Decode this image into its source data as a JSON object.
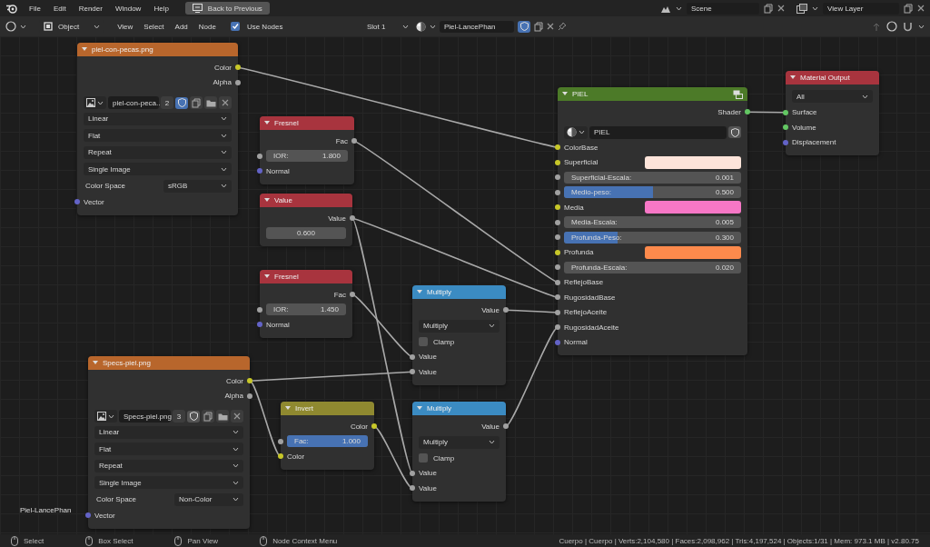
{
  "topbar": {
    "menus": [
      "File",
      "Edit",
      "Render",
      "Window",
      "Help"
    ],
    "back_button": "Back to Previous",
    "scene": "Scene",
    "view_layer": "View Layer"
  },
  "editor_header": {
    "mode": "Object",
    "menus": [
      "View",
      "Select",
      "Add",
      "Node"
    ],
    "use_nodes": {
      "label": "Use Nodes",
      "checked": true
    },
    "slot": "Slot 1",
    "material": "Piel-LancePhan",
    "fake_user": true
  },
  "nodes": [
    {
      "title": "piel-con-pecas.png",
      "kind": "texture",
      "expanded": true,
      "rows": [
        {
          "kind": "output",
          "label": "Color",
          "socket": {
            "color": "#c7c729"
          }
        },
        {
          "kind": "output",
          "label": "Alpha",
          "socket": {
            "color": "#a1a1a1"
          }
        },
        {
          "kind": "image",
          "name": "piel-con-peca...",
          "users": "2",
          "fake_user": true
        },
        {
          "kind": "dropdown",
          "value": "Linear"
        },
        {
          "kind": "dropdown",
          "value": "Flat"
        },
        {
          "kind": "dropdown",
          "value": "Repeat"
        },
        {
          "kind": "dropdown",
          "value": "Single Image"
        },
        {
          "kind": "dropdown",
          "label": "Color Space",
          "value": "sRGB"
        },
        {
          "kind": "input",
          "label": "Vector",
          "socket": {
            "color": "#6363c7"
          }
        }
      ]
    },
    {
      "title": "Fresnel",
      "kind": "input",
      "expanded": true,
      "rows": [
        {
          "kind": "output",
          "label": "Fac",
          "socket": {
            "color": "#a1a1a1"
          }
        },
        {
          "kind": "field",
          "label": "IOR:",
          "value": "1.800",
          "socket": {
            "color": "#a1a1a1"
          }
        },
        {
          "kind": "input",
          "label": "Normal",
          "socket": {
            "color": "#6363c7"
          }
        }
      ]
    },
    {
      "title": "Value",
      "kind": "input",
      "expanded": true,
      "rows": [
        {
          "kind": "output",
          "label": "Value",
          "socket": {
            "color": "#a1a1a1"
          }
        },
        {
          "kind": "field",
          "value": "0.600"
        }
      ]
    },
    {
      "title": "Fresnel",
      "kind": "input",
      "expanded": true,
      "rows": [
        {
          "kind": "output",
          "label": "Fac",
          "socket": {
            "color": "#a1a1a1"
          }
        },
        {
          "kind": "field",
          "label": "IOR:",
          "value": "1.450",
          "socket": {
            "color": "#a1a1a1"
          }
        },
        {
          "kind": "input",
          "label": "Normal",
          "socket": {
            "color": "#6363c7"
          }
        }
      ]
    },
    {
      "title": "Multiply",
      "kind": "converter",
      "expanded": true,
      "rows": [
        {
          "kind": "output",
          "label": "Value",
          "socket": {
            "color": "#a1a1a1"
          }
        },
        {
          "kind": "dropdown",
          "value": "Multiply"
        },
        {
          "kind": "checkbox",
          "label": "Clamp",
          "checked": false
        },
        {
          "kind": "input",
          "label": "Value",
          "socket": {
            "color": "#a1a1a1"
          }
        },
        {
          "kind": "input",
          "label": "Value",
          "socket": {
            "color": "#a1a1a1"
          }
        }
      ]
    },
    {
      "title": "Specs-piel.png",
      "kind": "texture",
      "expanded": true,
      "rows": [
        {
          "kind": "output",
          "label": "Color",
          "socket": {
            "color": "#c7c729"
          }
        },
        {
          "kind": "output",
          "label": "Alpha",
          "socket": {
            "color": "#a1a1a1"
          }
        },
        {
          "kind": "image",
          "name": "Specs-piel.png",
          "users": "3",
          "fake_user": false
        },
        {
          "kind": "dropdown",
          "value": "Linear"
        },
        {
          "kind": "dropdown",
          "value": "Flat"
        },
        {
          "kind": "dropdown",
          "value": "Repeat"
        },
        {
          "kind": "dropdown",
          "value": "Single Image"
        },
        {
          "kind": "dropdown",
          "label": "Color Space",
          "value": "Non-Color"
        },
        {
          "kind": "input",
          "label": "Vector",
          "socket": {
            "color": "#6363c7"
          }
        }
      ]
    },
    {
      "title": "Invert",
      "kind": "color",
      "expanded": true,
      "rows": [
        {
          "kind": "output",
          "label": "Color",
          "socket": {
            "color": "#c7c729"
          }
        },
        {
          "kind": "field",
          "label": "Fac:",
          "value": "1.000",
          "level": 1,
          "socket": {
            "color": "#a1a1a1"
          }
        },
        {
          "kind": "input",
          "label": "Color",
          "socket": {
            "color": "#c7c729"
          }
        }
      ]
    },
    {
      "title": "Multiply",
      "kind": "converter",
      "expanded": true,
      "rows": [
        {
          "kind": "output",
          "label": "Value",
          "socket": {
            "color": "#a1a1a1"
          }
        },
        {
          "kind": "dropdown",
          "value": "Multiply"
        },
        {
          "kind": "checkbox",
          "label": "Clamp",
          "checked": false
        },
        {
          "kind": "input",
          "label": "Value",
          "socket": {
            "color": "#a1a1a1"
          }
        },
        {
          "kind": "input",
          "label": "Value",
          "socket": {
            "color": "#a1a1a1"
          }
        }
      ]
    },
    {
      "title": "PIEL",
      "kind": "group",
      "expanded": true,
      "rows": [
        {
          "kind": "output",
          "label": "Shader",
          "socket": {
            "color": "#63c763"
          }
        },
        {
          "kind": "datablock",
          "name": "PIEL",
          "fake_user": false
        },
        {
          "kind": "input",
          "label": "ColorBase",
          "socket": {
            "color": "#c7c729"
          }
        },
        {
          "kind": "color",
          "label": "Superficial",
          "socket": {
            "color": "#c7c729"
          },
          "color": "#fde4da"
        },
        {
          "kind": "field",
          "label": "Superficial-Escala:",
          "value": "0.001",
          "socket": {
            "color": "#a1a1a1"
          }
        },
        {
          "kind": "field",
          "label": "Medio-peso:",
          "value": "0.500",
          "level": 0.5,
          "socket": {
            "color": "#a1a1a1"
          }
        },
        {
          "kind": "color",
          "label": "Media",
          "socket": {
            "color": "#c7c729"
          },
          "color": "#f777c6"
        },
        {
          "kind": "field",
          "label": "Media-Escala:",
          "value": "0.005",
          "socket": {
            "color": "#a1a1a1"
          }
        },
        {
          "kind": "field",
          "label": "Profunda-Peso:",
          "value": "0.300",
          "level": 0.3,
          "socket": {
            "color": "#a1a1a1"
          }
        },
        {
          "kind": "color",
          "label": "Profunda",
          "socket": {
            "color": "#c7c729"
          },
          "color": "#fd8a4c"
        },
        {
          "kind": "field",
          "label": "Profunda-Escala:",
          "value": "0.020",
          "socket": {
            "color": "#a1a1a1"
          }
        },
        {
          "kind": "input",
          "label": "ReflejoBase",
          "socket": {
            "color": "#a1a1a1"
          }
        },
        {
          "kind": "input",
          "label": "RugosidadBase",
          "socket": {
            "color": "#a1a1a1"
          }
        },
        {
          "kind": "input",
          "label": "ReflejoAceite",
          "socket": {
            "color": "#a1a1a1"
          }
        },
        {
          "kind": "input",
          "label": "RugosidadAceite",
          "socket": {
            "color": "#a1a1a1"
          }
        },
        {
          "kind": "input",
          "label": "Normal",
          "socket": {
            "color": "#6363c7"
          }
        }
      ]
    },
    {
      "title": "Material Output",
      "kind": "output",
      "expanded": true,
      "rows": [
        {
          "kind": "dropdown",
          "value": "All"
        },
        {
          "kind": "input",
          "label": "Surface",
          "socket": {
            "color": "#63c763"
          }
        },
        {
          "kind": "input",
          "label": "Volume",
          "socket": {
            "color": "#63c763"
          }
        },
        {
          "kind": "input",
          "label": "Displacement",
          "socket": {
            "color": "#6363c7"
          }
        }
      ]
    }
  ],
  "material_label": "Piel-LancePhan",
  "status_bar": {
    "hints": [
      "Select",
      "Box Select",
      "Pan View",
      "Node Context Menu"
    ],
    "stats": "Cuerpo | Cuerpo | Verts:2,104,580 | Faces:2,098,962 | Tris:4,197,524 | Objects:1/31 | Mem: 973.1 MB | v2.80.75"
  }
}
